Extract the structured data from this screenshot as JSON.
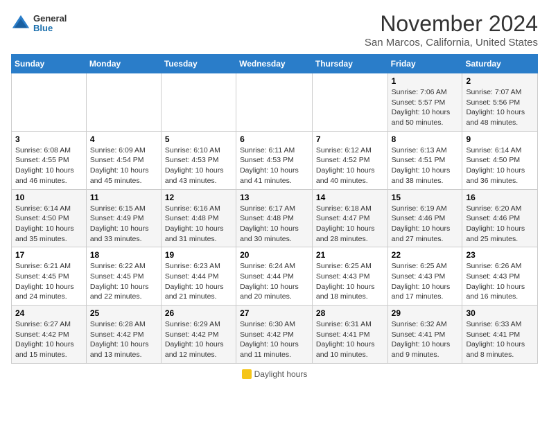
{
  "header": {
    "logo_general": "General",
    "logo_blue": "Blue",
    "title": "November 2024",
    "location": "San Marcos, California, United States"
  },
  "calendar": {
    "days_of_week": [
      "Sunday",
      "Monday",
      "Tuesday",
      "Wednesday",
      "Thursday",
      "Friday",
      "Saturday"
    ],
    "weeks": [
      [
        {
          "day": "",
          "info": ""
        },
        {
          "day": "",
          "info": ""
        },
        {
          "day": "",
          "info": ""
        },
        {
          "day": "",
          "info": ""
        },
        {
          "day": "",
          "info": ""
        },
        {
          "day": "1",
          "info": "Sunrise: 7:06 AM\nSunset: 5:57 PM\nDaylight: 10 hours and 50 minutes."
        },
        {
          "day": "2",
          "info": "Sunrise: 7:07 AM\nSunset: 5:56 PM\nDaylight: 10 hours and 48 minutes."
        }
      ],
      [
        {
          "day": "3",
          "info": "Sunrise: 6:08 AM\nSunset: 4:55 PM\nDaylight: 10 hours and 46 minutes."
        },
        {
          "day": "4",
          "info": "Sunrise: 6:09 AM\nSunset: 4:54 PM\nDaylight: 10 hours and 45 minutes."
        },
        {
          "day": "5",
          "info": "Sunrise: 6:10 AM\nSunset: 4:53 PM\nDaylight: 10 hours and 43 minutes."
        },
        {
          "day": "6",
          "info": "Sunrise: 6:11 AM\nSunset: 4:53 PM\nDaylight: 10 hours and 41 minutes."
        },
        {
          "day": "7",
          "info": "Sunrise: 6:12 AM\nSunset: 4:52 PM\nDaylight: 10 hours and 40 minutes."
        },
        {
          "day": "8",
          "info": "Sunrise: 6:13 AM\nSunset: 4:51 PM\nDaylight: 10 hours and 38 minutes."
        },
        {
          "day": "9",
          "info": "Sunrise: 6:14 AM\nSunset: 4:50 PM\nDaylight: 10 hours and 36 minutes."
        }
      ],
      [
        {
          "day": "10",
          "info": "Sunrise: 6:14 AM\nSunset: 4:50 PM\nDaylight: 10 hours and 35 minutes."
        },
        {
          "day": "11",
          "info": "Sunrise: 6:15 AM\nSunset: 4:49 PM\nDaylight: 10 hours and 33 minutes."
        },
        {
          "day": "12",
          "info": "Sunrise: 6:16 AM\nSunset: 4:48 PM\nDaylight: 10 hours and 31 minutes."
        },
        {
          "day": "13",
          "info": "Sunrise: 6:17 AM\nSunset: 4:48 PM\nDaylight: 10 hours and 30 minutes."
        },
        {
          "day": "14",
          "info": "Sunrise: 6:18 AM\nSunset: 4:47 PM\nDaylight: 10 hours and 28 minutes."
        },
        {
          "day": "15",
          "info": "Sunrise: 6:19 AM\nSunset: 4:46 PM\nDaylight: 10 hours and 27 minutes."
        },
        {
          "day": "16",
          "info": "Sunrise: 6:20 AM\nSunset: 4:46 PM\nDaylight: 10 hours and 25 minutes."
        }
      ],
      [
        {
          "day": "17",
          "info": "Sunrise: 6:21 AM\nSunset: 4:45 PM\nDaylight: 10 hours and 24 minutes."
        },
        {
          "day": "18",
          "info": "Sunrise: 6:22 AM\nSunset: 4:45 PM\nDaylight: 10 hours and 22 minutes."
        },
        {
          "day": "19",
          "info": "Sunrise: 6:23 AM\nSunset: 4:44 PM\nDaylight: 10 hours and 21 minutes."
        },
        {
          "day": "20",
          "info": "Sunrise: 6:24 AM\nSunset: 4:44 PM\nDaylight: 10 hours and 20 minutes."
        },
        {
          "day": "21",
          "info": "Sunrise: 6:25 AM\nSunset: 4:43 PM\nDaylight: 10 hours and 18 minutes."
        },
        {
          "day": "22",
          "info": "Sunrise: 6:25 AM\nSunset: 4:43 PM\nDaylight: 10 hours and 17 minutes."
        },
        {
          "day": "23",
          "info": "Sunrise: 6:26 AM\nSunset: 4:43 PM\nDaylight: 10 hours and 16 minutes."
        }
      ],
      [
        {
          "day": "24",
          "info": "Sunrise: 6:27 AM\nSunset: 4:42 PM\nDaylight: 10 hours and 15 minutes."
        },
        {
          "day": "25",
          "info": "Sunrise: 6:28 AM\nSunset: 4:42 PM\nDaylight: 10 hours and 13 minutes."
        },
        {
          "day": "26",
          "info": "Sunrise: 6:29 AM\nSunset: 4:42 PM\nDaylight: 10 hours and 12 minutes."
        },
        {
          "day": "27",
          "info": "Sunrise: 6:30 AM\nSunset: 4:42 PM\nDaylight: 10 hours and 11 minutes."
        },
        {
          "day": "28",
          "info": "Sunrise: 6:31 AM\nSunset: 4:41 PM\nDaylight: 10 hours and 10 minutes."
        },
        {
          "day": "29",
          "info": "Sunrise: 6:32 AM\nSunset: 4:41 PM\nDaylight: 10 hours and 9 minutes."
        },
        {
          "day": "30",
          "info": "Sunrise: 6:33 AM\nSunset: 4:41 PM\nDaylight: 10 hours and 8 minutes."
        }
      ]
    ]
  },
  "footer": {
    "daylight_label": "Daylight hours"
  }
}
